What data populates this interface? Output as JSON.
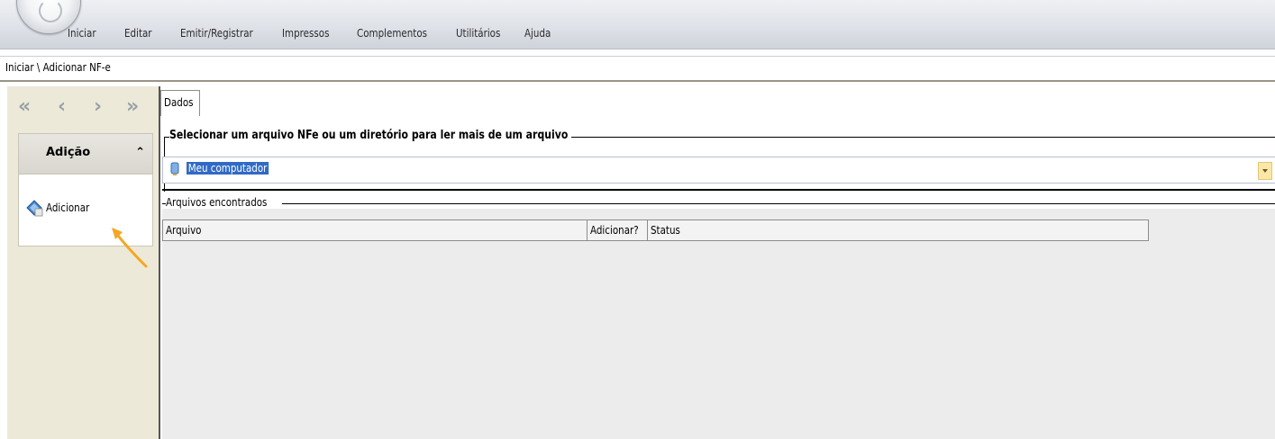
{
  "menu": {
    "items": [
      "Iniciar",
      "Editar",
      "Emitir/Registrar",
      "Impressos",
      "Complementos",
      "Utilitários",
      "Ajuda"
    ]
  },
  "breadcrumb": "Iniciar \\ Adicionar NF-e",
  "nav": {
    "first_icon": "first-page-icon",
    "prev_icon": "previous-icon",
    "next_icon": "next-icon",
    "last_icon": "last-page-icon"
  },
  "left_group": {
    "title": "Adição",
    "items": [
      {
        "label": "Adicionar",
        "icon": "add-document-icon"
      }
    ]
  },
  "tabs": [
    {
      "label": "Dados",
      "active": true
    }
  ],
  "selection": {
    "legend": "Selecionar um arquivo NFe ou um diretório para ler mais de um arquivo",
    "combo_value": "Meu computador",
    "combo_icon": "computer-icon"
  },
  "files": {
    "legend": "Arquivos encontrados",
    "columns": [
      "Arquivo",
      "Adicionar?",
      "Status"
    ],
    "rows": []
  },
  "colors": {
    "menubar": "#dfe2e8",
    "leftpane": "#ece9d8",
    "selection_highlight": "#316ac5",
    "annotation_arrow": "#f5a623"
  }
}
